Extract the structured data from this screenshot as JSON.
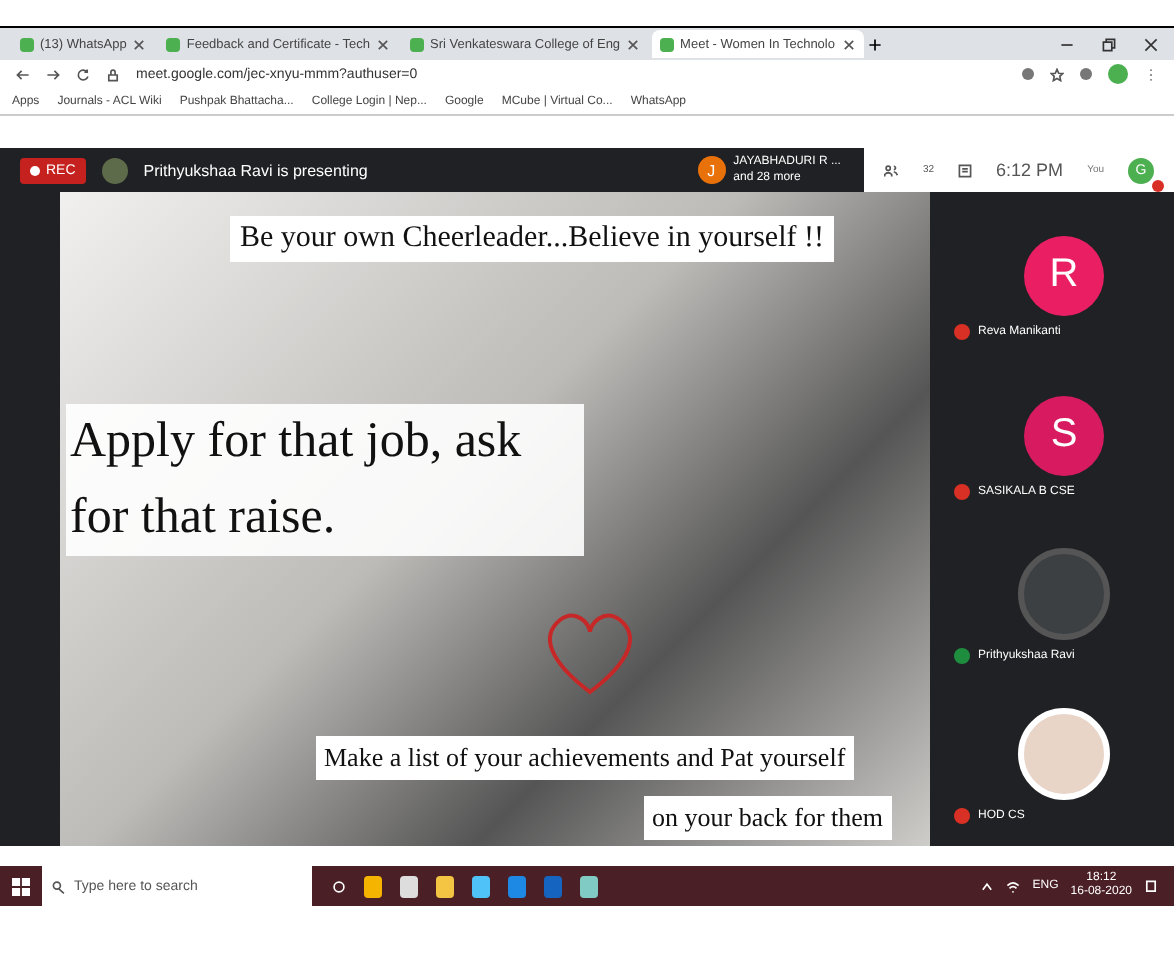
{
  "browser": {
    "tabs": [
      {
        "title": "(13) WhatsApp",
        "selected": false
      },
      {
        "title": "Feedback and Certificate - Tech",
        "selected": false
      },
      {
        "title": "Sri Venkateswara College of Eng",
        "selected": false
      },
      {
        "title": "Meet - Women In Technolo",
        "selected": true
      }
    ],
    "url": "meet.google.com/jec-xnyu-mmm?authuser=0",
    "bookmarks": [
      "Apps",
      "Journals - ACL Wiki",
      "Pushpak Bhattacha...",
      "College Login | Nep...",
      "Google",
      "MCube | Virtual Co...",
      "WhatsApp"
    ]
  },
  "meet": {
    "rec": "REC",
    "presenter": "Prithyukshaa Ravi is presenting",
    "speaker_initial": "J",
    "speaker_name": "JAYABHADURI R ...",
    "speaker_more": "and 28 more",
    "people_count": "32",
    "time": "6:12 PM",
    "self_label": "You",
    "self_initial": "G"
  },
  "slide": {
    "texts": [
      {
        "kind": "banner",
        "text": "Be your own Cheerleader...Believe in yourself !!"
      },
      {
        "kind": "headline",
        "text": "Apply for that job, ask for that raise."
      },
      {
        "kind": "caption",
        "text": "Make a list of your achievements and Pat yourself"
      },
      {
        "kind": "caption2",
        "text": "on your back for them"
      }
    ]
  },
  "participants": [
    {
      "name": "Reva Manikanti",
      "kind": "letter",
      "initial": "R",
      "color": "#e91e63",
      "muted": true
    },
    {
      "name": "SASIKALA B CSE",
      "kind": "letter",
      "initial": "S",
      "color": "#d81b60",
      "muted": true
    },
    {
      "name": "Prithyukshaa Ravi",
      "kind": "photo",
      "muted": false
    },
    {
      "name": "HOD CS",
      "kind": "photo",
      "muted": true
    }
  ],
  "taskbar": {
    "search_placeholder": "Type here to search",
    "language": "ENG",
    "time": "18:12",
    "date": "16-08-2020"
  }
}
